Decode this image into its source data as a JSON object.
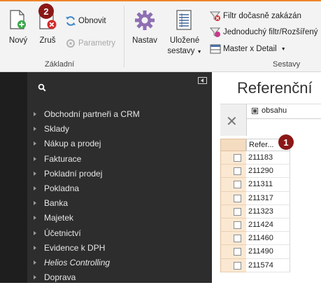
{
  "ribbon": {
    "groups": {
      "basic_label": "Základní",
      "sets_label": "Sestavy"
    },
    "buttons": {
      "new": "Nový",
      "delete": "Zruš",
      "refresh": "Obnovit",
      "parameters": "Parametry",
      "settings": "Nastav",
      "saved_sets_line1": "Uložené",
      "saved_sets_line2": "sestavy",
      "filter_temp_off": "Filtr dočasně zakázán",
      "simple_filter": "Jednoduchý filtr/Rozšířený",
      "master_detail": "Master x Detail"
    },
    "icons": {
      "new": "new-document-icon",
      "delete": "delete-document-icon",
      "refresh": "refresh-icon",
      "parameters": "parameters-icon",
      "settings": "gear-icon",
      "saved_sets": "saved-sets-icon",
      "filter": "filter-icon"
    },
    "accent": "#f0842b"
  },
  "badges": {
    "badge1": "1",
    "badge2": "2",
    "color": "#8b1717"
  },
  "nav": {
    "items": [
      {
        "label": "Obchodní partneři a CRM",
        "italic": false
      },
      {
        "label": "Sklady",
        "italic": false
      },
      {
        "label": "Nákup a prodej",
        "italic": false
      },
      {
        "label": "Fakturace",
        "italic": false
      },
      {
        "label": "Pokladní prodej",
        "italic": false
      },
      {
        "label": "Pokladna",
        "italic": false
      },
      {
        "label": "Banka",
        "italic": false
      },
      {
        "label": "Majetek",
        "italic": false
      },
      {
        "label": "Účetnictví",
        "italic": false
      },
      {
        "label": "Evidence k DPH",
        "italic": false
      },
      {
        "label": "Helios Controlling",
        "italic": true
      },
      {
        "label": "Doprava",
        "italic": false
      }
    ]
  },
  "content": {
    "title": "Referenční",
    "filter_text": "obsahu",
    "grid": {
      "column_header": "Refer...",
      "rows": [
        "211183",
        "211290",
        "211311",
        "211317",
        "211323",
        "211424",
        "211460",
        "211490",
        "211574"
      ]
    }
  }
}
